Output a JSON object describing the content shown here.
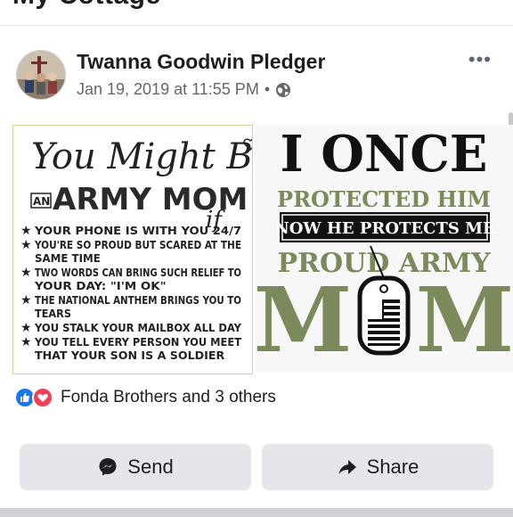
{
  "top_cut_text": "My Cottage",
  "post": {
    "author": "Twanna Goodwin Pledger",
    "timestamp": "Jan 19, 2019 at 11:55 PM",
    "separator": "•",
    "privacy_icon": "globe-icon",
    "more_label": "•••"
  },
  "image_left": {
    "script_line": "You Might Be",
    "an": "AN",
    "big": "ARMY MOM",
    "if": "if",
    "items": [
      [
        "YOUR PHONE IS WITH YOU 24/7"
      ],
      [
        "YOU'RE SO PROUD BUT SCARED AT THE",
        "SAME TIME"
      ],
      [
        "TWO WORDS CAN BRING SUCH RELIEF TO",
        "YOUR DAY: \"I'M OK\""
      ],
      [
        "THE NATIONAL ANTHEM BRINGS YOU TO",
        "TEARS"
      ],
      [
        "YOU STALK YOUR MAILBOX ALL DAY"
      ],
      [
        "YOU TELL EVERY PERSON YOU MEET",
        "THAT YOUR SON IS A SOLDIER"
      ]
    ]
  },
  "image_right": {
    "line1": "I ONCE",
    "line2": "PROTECTED HIM",
    "line3": "NOW HE PROTECTS ME",
    "line4": "PROUD ARMY",
    "line5_m1": "M",
    "line5_m2": "M"
  },
  "reactions": {
    "text": "Fonda Brothers and 3 others",
    "icons": [
      "like-icon",
      "love-icon"
    ]
  },
  "actions": {
    "send_label": "Send",
    "share_label": "Share"
  },
  "colors": {
    "facebook_blue": "#1877f2",
    "love_red": "#f33e58",
    "army_green": "#7b8a5b",
    "button_bg": "#e4e6eb"
  }
}
